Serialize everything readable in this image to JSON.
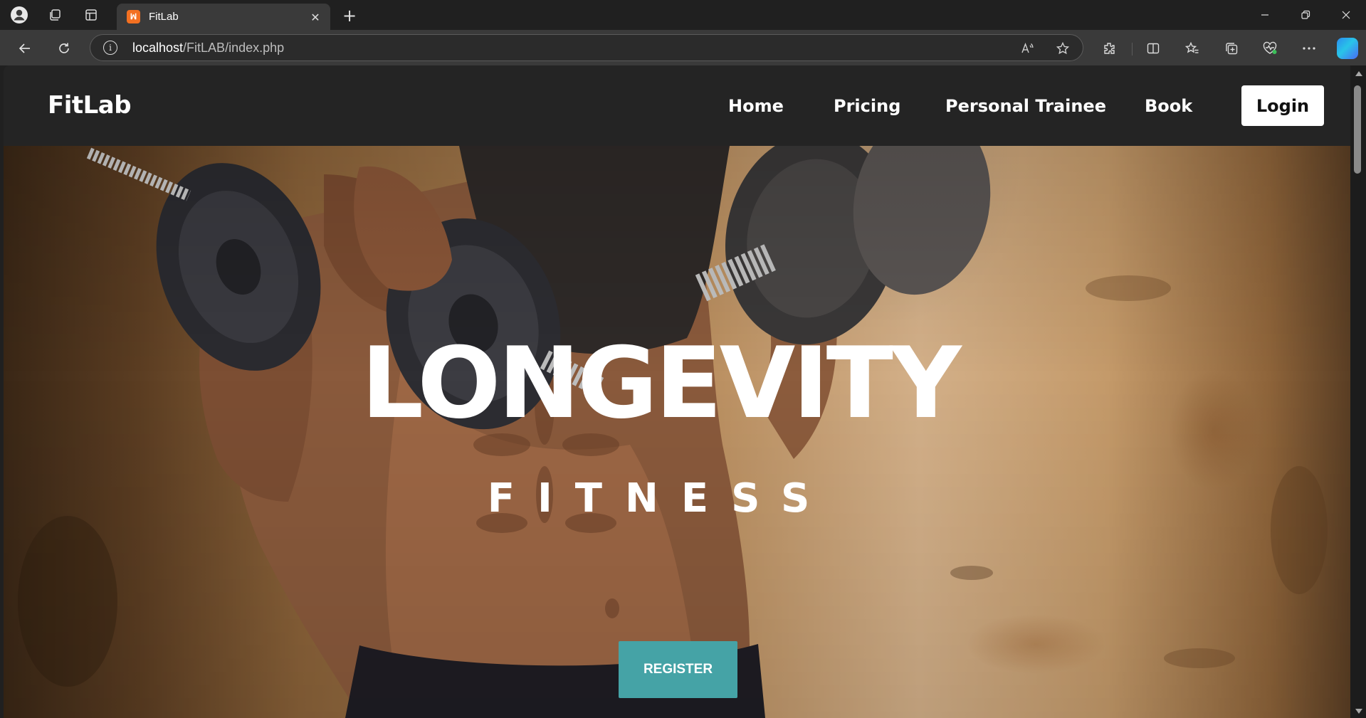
{
  "browser": {
    "tab_title": "FitLab",
    "tab_favicon_text": "ꟽ",
    "address": {
      "host": "localhost",
      "path": "/FitLAB/index.php"
    },
    "colors": {
      "chrome_bg": "#202020",
      "toolbar_bg": "#3a3a3a",
      "favicon": "#f37021"
    }
  },
  "site": {
    "brand": "FitLab",
    "nav": {
      "home": "Home",
      "pricing": "Pricing",
      "personal_trainee": "Personal Trainee",
      "book": "Book",
      "login": "Login"
    },
    "hero": {
      "title": "LONGEVITY",
      "subtitle": "FITNESS",
      "register": "REGISTER"
    },
    "colors": {
      "nav_bg": "#242424",
      "register_btn": "#45a3a6",
      "login_btn": "#ffffff"
    }
  }
}
